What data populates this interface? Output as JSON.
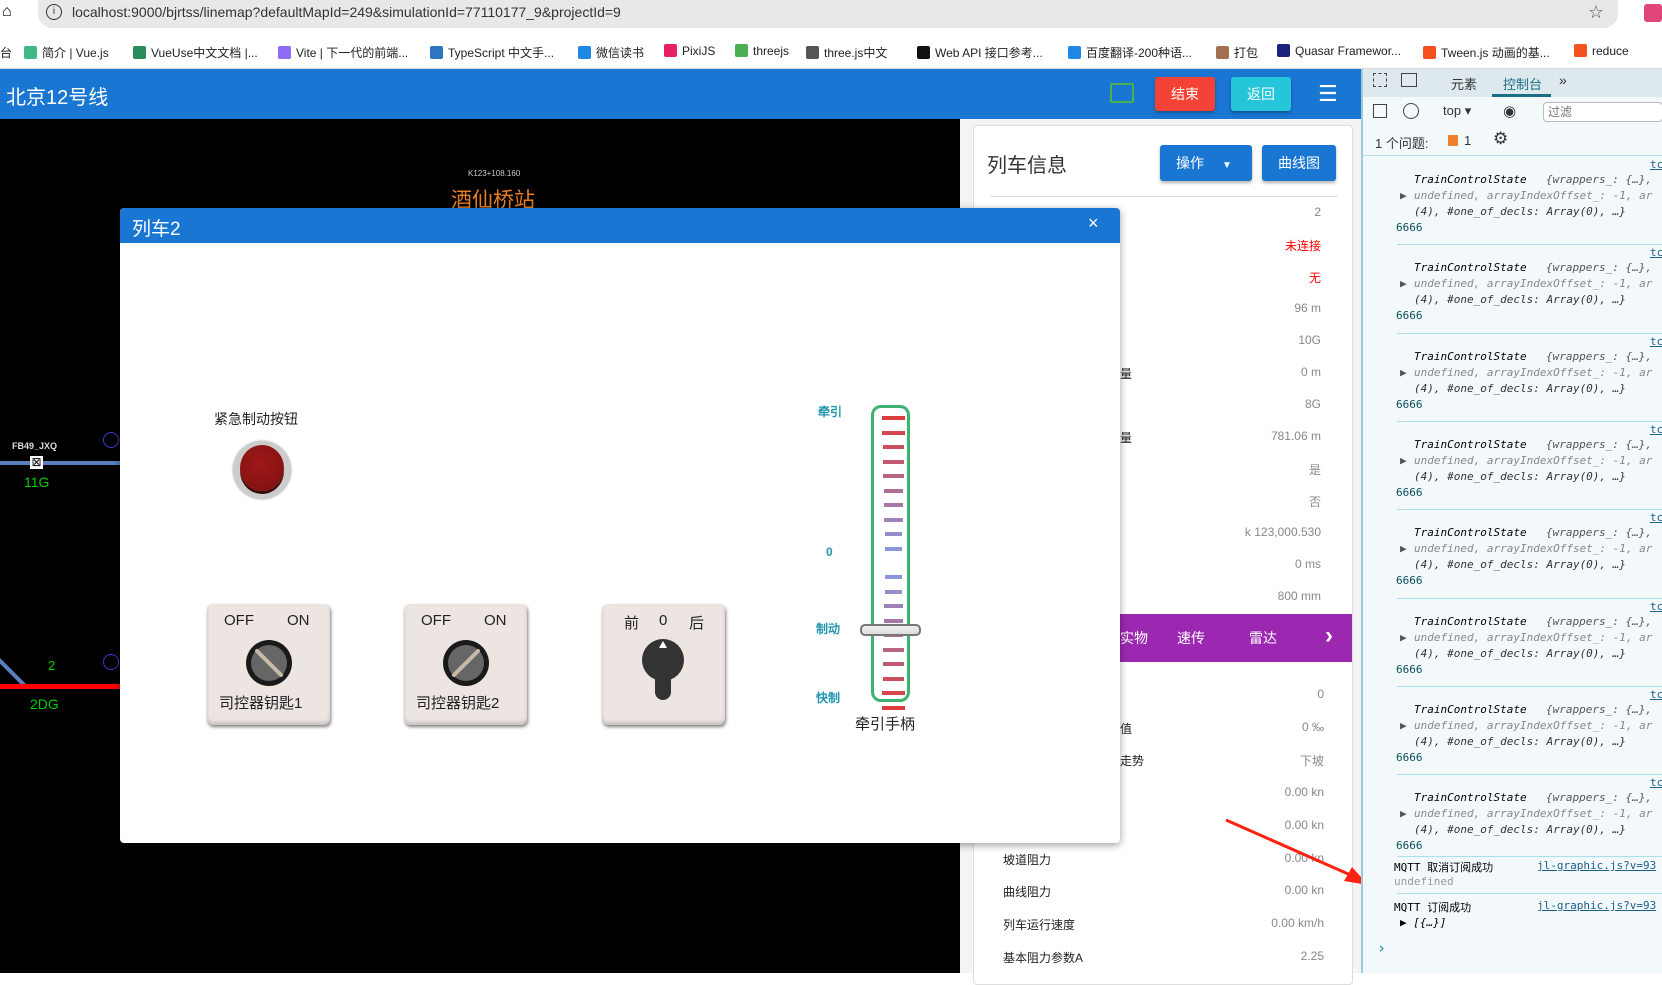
{
  "browser": {
    "url": "localhost:9000/bjrtss/linemap?defaultMapId=249&simulationId=77110177_9&projectId=9",
    "bookmarks": [
      {
        "label": "台",
        "color": "#ffffff"
      },
      {
        "label": "简介 | Vue.js",
        "color": "#41b883"
      },
      {
        "label": "VueUse中文文档 |...",
        "color": "#2a8c5a"
      },
      {
        "label": "Vite | 下一代的前端...",
        "color": "#8f6cf7"
      },
      {
        "label": "TypeScript 中文手...",
        "color": "#2f74c0"
      },
      {
        "label": "微信读书",
        "color": "#1e88e5"
      },
      {
        "label": "PixiJS",
        "color": "#e91e63"
      },
      {
        "label": "threejs",
        "color": "#4caf50"
      },
      {
        "label": "three.js中文",
        "color": "#555555"
      },
      {
        "label": "Web API 接口参考...",
        "color": "#111111"
      },
      {
        "label": "百度翻译-200种语...",
        "color": "#1e88e5"
      },
      {
        "label": "打包",
        "color": "#a07050"
      },
      {
        "label": "Quasar Framewor...",
        "color": "#1a237e"
      },
      {
        "label": "Tween.js 动画的基...",
        "color": "#f4511e"
      },
      {
        "label": "reduce",
        "color": "#f4511e"
      }
    ]
  },
  "header": {
    "title": "北京12号线",
    "end_label": "结束",
    "back_label": "返回",
    "end_color": "#f44336",
    "back_color": "#26c6da",
    "brand_color": "#1976d2"
  },
  "map": {
    "station_km": "K123+108.160",
    "station_name": "酒仙桥站",
    "signal_label": "FB49_JXQ",
    "section_11g": "11G",
    "section_2": "2",
    "section_2dg": "2DG"
  },
  "panel": {
    "title": "列车信息",
    "op_label": "操作",
    "curve_label": "曲线图",
    "rows_top": [
      {
        "label": "",
        "value": "2"
      },
      {
        "label": "",
        "value": "未连接",
        "red": true
      },
      {
        "label": "",
        "value": "无",
        "red": true
      },
      {
        "label": "",
        "value": "96 m"
      },
      {
        "label": "",
        "value": "10G"
      },
      {
        "label": "量",
        "value": "0 m"
      },
      {
        "label": "",
        "value": "8G"
      },
      {
        "label": "量",
        "value": "781.06 m"
      },
      {
        "label": "",
        "value": "是"
      },
      {
        "label": "",
        "value": "否"
      },
      {
        "label": "",
        "value": "k 123,000.530"
      },
      {
        "label": "",
        "value": "0 ms"
      },
      {
        "label": "",
        "value": "800 mm"
      }
    ],
    "tabs": [
      "实物",
      "速传",
      "雷达"
    ],
    "rows_bottom": [
      {
        "label": "",
        "value": "0"
      },
      {
        "label": "值",
        "value": "0 ‰"
      },
      {
        "label": "走势",
        "value": "下坡"
      },
      {
        "label": "",
        "value": "0.00 kn"
      },
      {
        "label": "",
        "value": "0.00 kn"
      },
      {
        "label": "坡道阻力",
        "value": "0.00 kn"
      },
      {
        "label": "曲线阻力",
        "value": "0.00 kn"
      },
      {
        "label": "列车运行速度",
        "value": "0.00 km/h"
      },
      {
        "label": "基本阻力参数A",
        "value": "2.25"
      }
    ]
  },
  "dialog": {
    "title": "列车2",
    "emergency_label": "紧急制动按钮",
    "key1": {
      "off": "OFF",
      "on": "ON",
      "label": "司控器钥匙1",
      "state": "OFF"
    },
    "key2": {
      "off": "OFF",
      "on": "ON",
      "label": "司控器钥匙2",
      "state": "ON"
    },
    "direction": {
      "fwd": "前",
      "zero": "0",
      "back": "后",
      "state": "0"
    },
    "handle": {
      "label": "牵引手柄",
      "traction": "牵引",
      "zero": "0",
      "brake": "制动",
      "emergency": "快制",
      "position": "制动"
    }
  },
  "devtools": {
    "tab_elements": "元素",
    "tab_console": "控制台",
    "context": "top",
    "filter_placeholder": "过滤",
    "issues_label": "1 个问题:",
    "issues_count": "1",
    "entries": [
      {
        "src": "tc",
        "l1": "TrainControlState",
        "l1b": "{wrappers_: {…},",
        "l2": "undefined, arrayIndexOffset_: -1, ar",
        "l3": "(4), #one_of_decls: Array(0), …}",
        "l4": "6666"
      }
    ],
    "entry_count": 8,
    "mqtt1": {
      "text": "MQTT 取消订阅成功",
      "src": "jl-graphic.js?v=93",
      "sub": "undefined"
    },
    "mqtt2": {
      "text": "MQTT 订阅成功",
      "src": "jl-graphic.js?v=93",
      "sub": "▶ [{…}]"
    },
    "prompt": "›"
  }
}
